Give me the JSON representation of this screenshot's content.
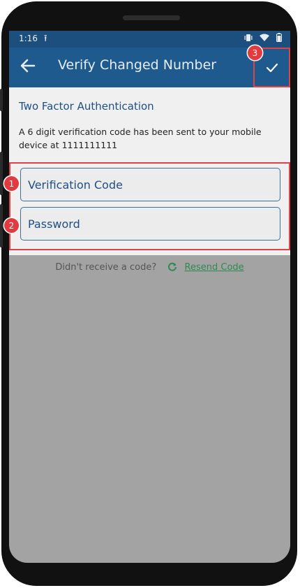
{
  "status_bar": {
    "time": "1:16",
    "upload_icon": "upload-icon",
    "icons": [
      "vibrate-icon",
      "wifi-icon",
      "battery-icon"
    ]
  },
  "app_bar": {
    "title": "Verify Changed Number",
    "back_icon": "back-arrow-icon",
    "confirm_icon": "check-icon"
  },
  "section": {
    "title": "Two Factor Authentication",
    "info": "A 6 digit verification code has been sent to your mobile device at 1111111111"
  },
  "form": {
    "verification_placeholder": "Verification Code",
    "password_placeholder": "Password"
  },
  "resend": {
    "prompt": "Didn't receive a code?",
    "link": "Resend Code",
    "icon": "refresh-icon"
  },
  "annotations": {
    "one": "1",
    "two": "2",
    "three": "3"
  },
  "colors": {
    "app_bar": "#1e5a8e",
    "accent_red": "#e0424a",
    "link_green": "#2f8a52",
    "screen_dim": "#a3a3a3"
  }
}
